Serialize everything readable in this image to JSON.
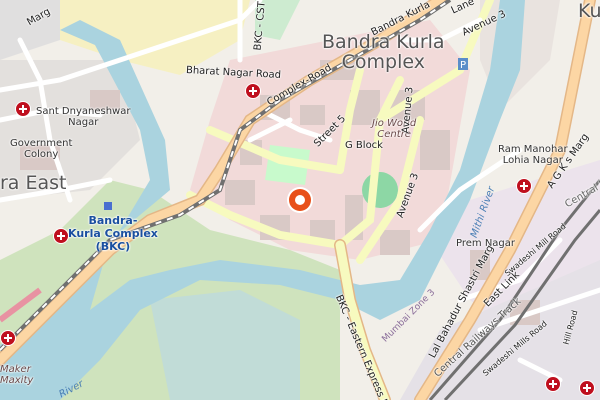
{
  "map": {
    "areas": {
      "bandra_kurla_complex": "Bandra Kurla\nComplex",
      "bandra_east": "ra East",
      "kurla": "Ku"
    },
    "neighbourhoods": {
      "sant_dnyaneshwar": "Sant Dnyaneshwar\nNagar",
      "government_colony": "Government\nColony",
      "ram_manohar": "Ram Manohar\nLohia Nagar",
      "prem_nagar": "Prem Nagar",
      "maker_maxity": "Maker\nMaxity"
    },
    "station": {
      "name": "Bandra-\nKurla Complex\n(BKC)"
    },
    "roads": {
      "bharat_nagar": "Bharat Nagar Road",
      "complex_road": "Complex-Road",
      "bandra_kurla_road": "Bandra Kurla",
      "cst_link": "BKC - CST Lin",
      "street_5": "Street 5",
      "g_block": "G Block",
      "avenue_3_a": "Avenue 3",
      "avenue_3_b": "Avenue 3",
      "avenue_3_c": "Avenue 3",
      "lane": "Lane",
      "eastern_express": "BKC - Eastern Express Hig",
      "lal_bahadur": "Lal Bahadur Shastri Marg",
      "east_link": "East Link",
      "central_railways": "Central Railways Track",
      "swadeshi_mill": "Swadeshi Mill Road",
      "swadeshi_mills": "Swadeshi Mills Road",
      "hill_road": "Hill Road",
      "ag_marg": "A G K s Marg",
      "central_r": "Central R",
      "marg": "Marg"
    },
    "places": {
      "jio_centre": "Jio World\nCentre"
    },
    "water": {
      "mithi_river_a": "Mithi River",
      "mithi_river_b": "River"
    },
    "zones": {
      "mumbai_zone_3": "Mumbai Zone 3"
    },
    "icons": [
      "hospital-icon",
      "station-icon",
      "location-marker-icon"
    ],
    "colors": {
      "background": "#f2efe9",
      "water": "#aad3df",
      "wetland": "#cfe3bd",
      "park": "#c8facc",
      "commercial": "#f2dad9",
      "primary_road": "#fcd6a4",
      "secondary_road": "#f7fabf",
      "motorway": "#e892a2",
      "railway": "#707070",
      "hospital": "#bf0f1e",
      "marker": "#e8501a"
    }
  }
}
